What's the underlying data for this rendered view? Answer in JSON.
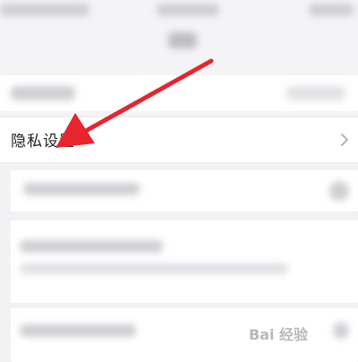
{
  "privacy_settings": {
    "label": "隐私设置"
  },
  "icons": {
    "chevron": "chevron-right-icon",
    "annotation_arrow": "red-arrow-icon"
  },
  "colors": {
    "arrow": "#e8242f",
    "row_bg": "#ffffff",
    "page_bg": "#f2f2f4",
    "text": "#222222",
    "chevron": "#b5b5b5"
  },
  "watermark": {
    "text": "Bai 经验"
  }
}
